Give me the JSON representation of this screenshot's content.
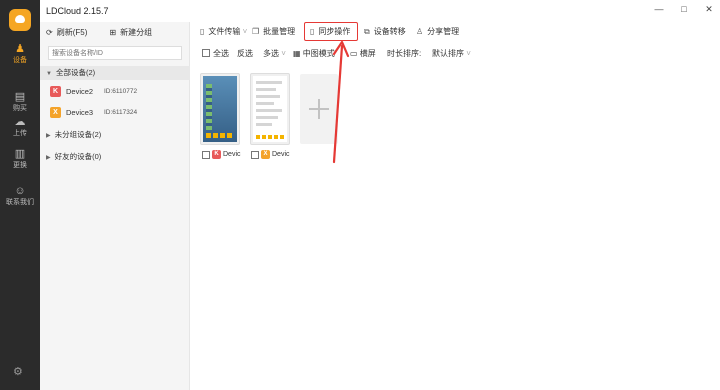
{
  "app": {
    "title": "LDCloud 2.15.7"
  },
  "window": {
    "minimize": "—",
    "maximize": "□",
    "close": "✕"
  },
  "rail": {
    "items": [
      {
        "label": "设备",
        "icon": "device-icon",
        "glyph": "♟"
      },
      {
        "label": "购买",
        "icon": "cart-icon",
        "glyph": "▤"
      },
      {
        "label": "上传",
        "icon": "upload-icon",
        "glyph": "☁"
      },
      {
        "label": "更换",
        "icon": "swap-icon",
        "glyph": "▥"
      },
      {
        "label": "联系我们",
        "icon": "contact-icon",
        "glyph": "☺"
      }
    ],
    "settings_glyph": "⚙"
  },
  "panel": {
    "refresh_label": "刷新(F5)",
    "new_group_label": "新建分组",
    "search_placeholder": "搜索设备名称/ID",
    "groups": {
      "all": "全部设备(2)",
      "ungrouped": "未分组设备(2)",
      "friends": "好友的设备(0)"
    },
    "devices": [
      {
        "name": "Device2",
        "id": "ID:6110772",
        "badge": "K",
        "color": "#e85a5a"
      },
      {
        "name": "Device3",
        "id": "ID:6117324",
        "badge": "X",
        "color": "#f4a32a"
      }
    ]
  },
  "toolbar": {
    "file_transfer": "文件传输",
    "batch_manage": "批量管理",
    "sync_operation": "同步操作",
    "device_transfer": "设备转移",
    "share_manage": "分享管理"
  },
  "toolbar2": {
    "select_all": "全选",
    "invert": "反选",
    "multi_select": "多选",
    "view_mode": "中图模式",
    "landscape": "横屏",
    "sort_by_duration": "时长排序:",
    "sort_default": "默认排序"
  },
  "cards": [
    {
      "label": "Devic",
      "badge": "K",
      "color": "#e85a5a"
    },
    {
      "label": "Devic",
      "badge": "X",
      "color": "#f4a32a"
    }
  ],
  "colors": {
    "accent": "#f5a623",
    "highlight": "#e53935"
  }
}
